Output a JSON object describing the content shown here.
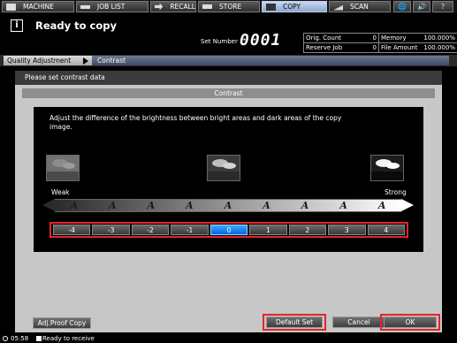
{
  "tabs": [
    {
      "label": "MACHINE",
      "icon": "machine-icon"
    },
    {
      "label": "JOB LIST",
      "icon": "job-list-icon"
    },
    {
      "label": "RECALL",
      "icon": "recall-icon"
    },
    {
      "label": "STORE",
      "icon": "store-icon"
    },
    {
      "label": "COPY",
      "icon": "copy-icon",
      "active": true
    },
    {
      "label": "SCAN",
      "icon": "scan-icon"
    }
  ],
  "tab_icons": {
    "globe": "🌐",
    "volume": "🔊",
    "help": "?"
  },
  "header": {
    "status": "Ready to copy",
    "set_number_label": "Set Number",
    "set_number_value": "0001",
    "stats": {
      "orig_count_label": "Orig. Count",
      "orig_count_value": "0",
      "memory_label": "Memory",
      "memory_value": "100.000%",
      "reserve_job_label": "Reserve Job",
      "reserve_job_value": "0",
      "file_amount_label": "File Amount",
      "file_amount_value": "100.000%"
    }
  },
  "breadcrumb": {
    "parent": "Quality Adjustment",
    "current": "Contrast"
  },
  "panel": {
    "instruction": "Please set contrast data",
    "section_title": "Contrast",
    "description": "Adjust the difference of the brightness between bright areas and dark areas of the copy image.",
    "weak_label": "Weak",
    "strong_label": "Strong",
    "glyph": "A",
    "steps": [
      "-4",
      "-3",
      "-2",
      "-1",
      "0",
      "1",
      "2",
      "3",
      "4"
    ],
    "selected_step": "0"
  },
  "buttons": {
    "adj_proof_copy": "Adj.Proof Copy",
    "default_set": "Default Set",
    "cancel": "Cancel",
    "ok": "OK"
  },
  "status_bar": {
    "time": "05:58",
    "message": "Ready to receive"
  },
  "colors": {
    "highlight": "#e5242a",
    "selected": "#0a7cf0",
    "active_tab": "#a9bde0"
  }
}
